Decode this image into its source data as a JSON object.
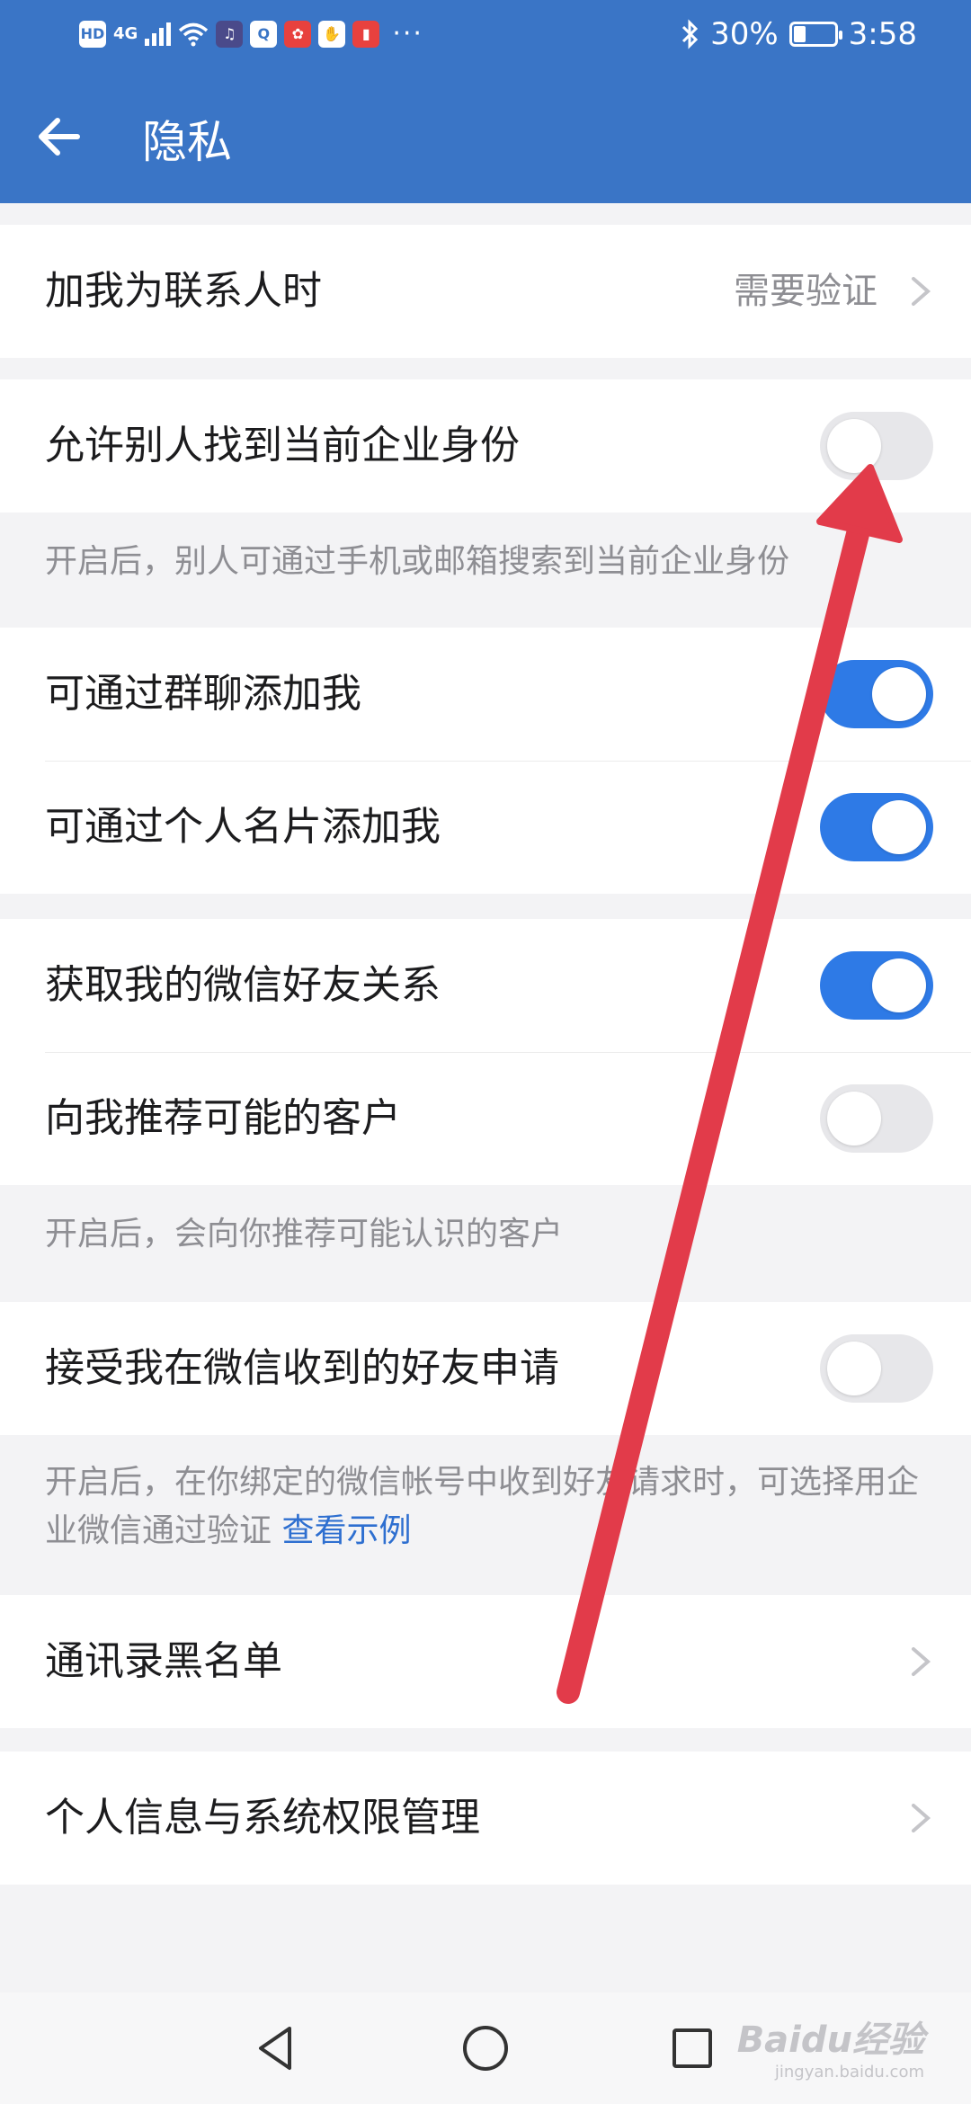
{
  "status_bar": {
    "hd": "HD",
    "network": "4G",
    "battery_percent": "30%",
    "time": "3:58",
    "battery_level": 0.3
  },
  "header": {
    "title": "隐私"
  },
  "rows": {
    "add_contact": {
      "label": "加我为联系人时",
      "value": "需要验证"
    },
    "find_identity": {
      "label": "允许别人找到当前企业身份",
      "on": false
    },
    "find_identity_note": "开启后，别人可通过手机或邮箱搜索到当前企业身份",
    "add_via_group": {
      "label": "可通过群聊添加我",
      "on": true
    },
    "add_via_card": {
      "label": "可通过个人名片添加我",
      "on": true
    },
    "wechat_friends": {
      "label": "获取我的微信好友关系",
      "on": true
    },
    "recommend_customers": {
      "label": "向我推荐可能的客户",
      "on": false
    },
    "recommend_note": "开启后，会向你推荐可能认识的客户",
    "accept_requests": {
      "label": "接受我在微信收到的好友申请",
      "on": false
    },
    "accept_note": "开启后，在你绑定的微信帐号中收到好友请求时，可选择用企业微信通过验证",
    "accept_note_link": "查看示例",
    "blacklist": {
      "label": "通讯录黑名单"
    },
    "permissions": {
      "label": "个人信息与系统权限管理"
    }
  },
  "watermark": {
    "brand": "Baidu经验",
    "url": "jingyan.baidu.com"
  },
  "colors": {
    "header_blue": "#3a75c6",
    "toggle_on": "#2e7ae6",
    "toggle_off": "#e7e7ea",
    "link": "#2e6fd0",
    "annotation_arrow": "#e23b4a"
  }
}
